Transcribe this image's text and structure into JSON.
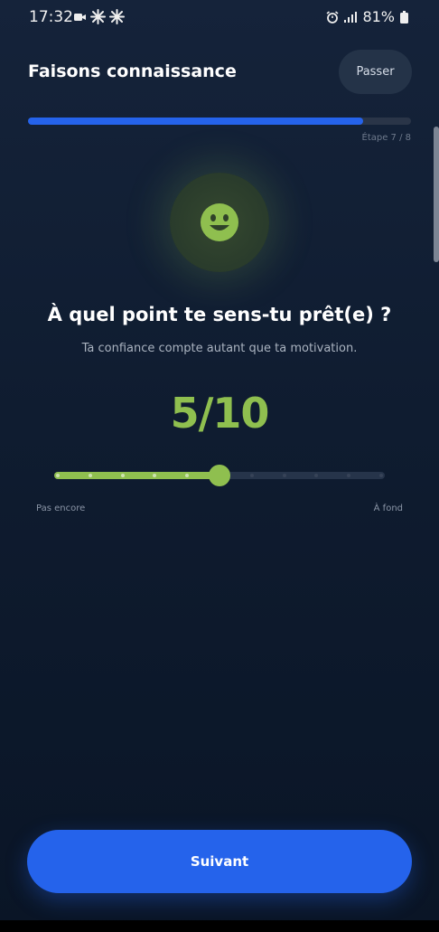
{
  "status_bar": {
    "time": "17:32",
    "battery": "81%"
  },
  "header": {
    "title": "Faisons connaissance",
    "skip_label": "Passer"
  },
  "progress": {
    "step_label": "Étape 7 / 8",
    "fraction": 0.875,
    "color": "#2563eb"
  },
  "question": {
    "title": "À quel point te sens-tu prêt(e) ?",
    "subtitle": "Ta confiance compte autant que ta motivation.",
    "icon": "smiley-face-icon"
  },
  "slider": {
    "score": "5/10",
    "value": 5,
    "min": 0,
    "max": 10,
    "min_label": "Pas encore",
    "max_label": "À fond",
    "accent": "#8fbf4f"
  },
  "footer": {
    "next_label": "Suivant"
  }
}
